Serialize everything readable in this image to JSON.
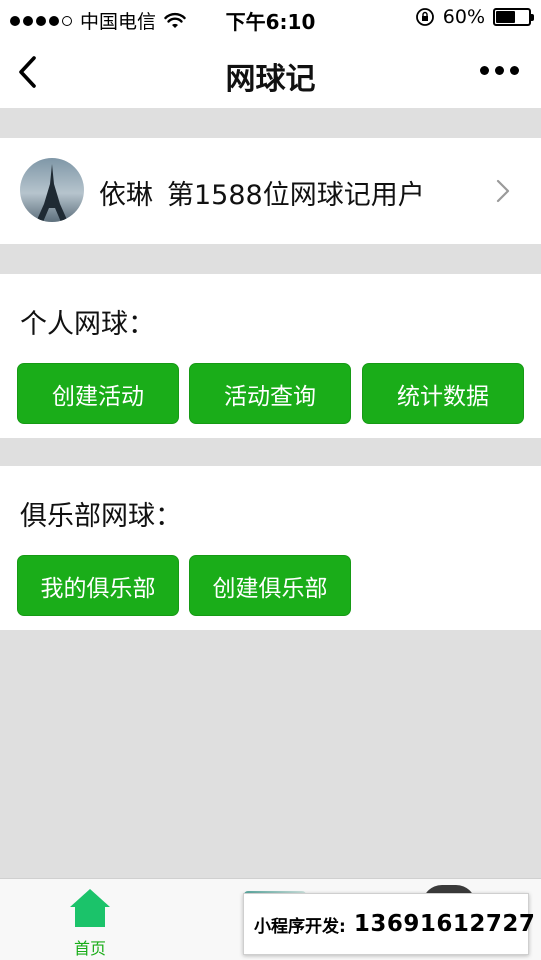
{
  "status_bar": {
    "carrier": "中国电信",
    "time": "下午6:10",
    "battery": "60%",
    "battery_level": 0.6
  },
  "nav": {
    "title": "网球记"
  },
  "profile": {
    "name": "依琳",
    "rank_text": "第1588位网球记用户"
  },
  "personal_section": {
    "title": "个人网球：",
    "buttons": [
      "创建活动",
      "活动查询",
      "统计数据"
    ]
  },
  "club_section": {
    "title": "俱乐部网球：",
    "buttons": [
      "我的俱乐部",
      "创建俱乐部"
    ]
  },
  "tab_bar": {
    "home_label": "首页"
  },
  "ad_overlay": {
    "label": "小程序开发:",
    "phone": "13691612727"
  },
  "colors": {
    "accent_green": "#1aad19",
    "tab_active": "#1aad19",
    "page_bg": "#dfdfdf"
  },
  "icons": [
    "signal-dots-icon",
    "wifi-icon",
    "rotation-lock-icon",
    "battery-icon",
    "back-arrow-icon",
    "more-dots-icon",
    "chevron-right-icon",
    "home-icon"
  ]
}
